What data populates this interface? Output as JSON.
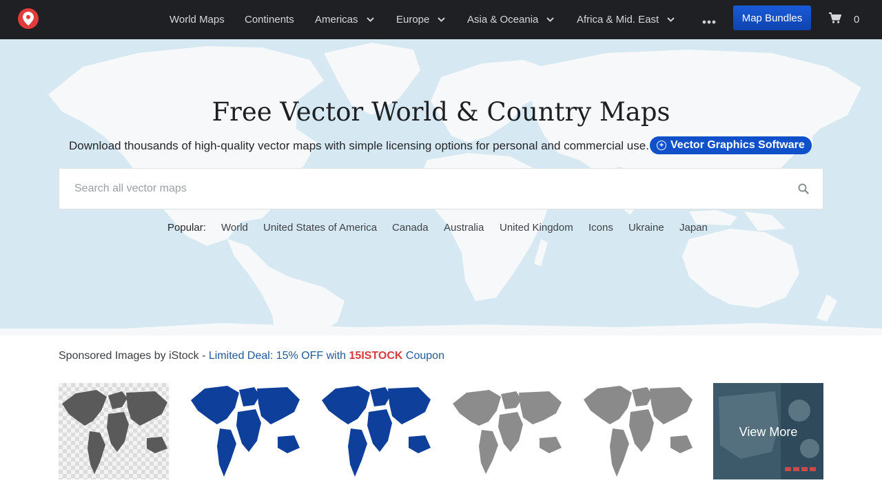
{
  "nav": {
    "items": [
      {
        "label": "World Maps"
      },
      {
        "label": "Continents"
      },
      {
        "label": "Americas"
      },
      {
        "label": "Europe"
      },
      {
        "label": "Asia & Oceania"
      },
      {
        "label": "Africa & Mid. East"
      }
    ],
    "more_icon": "more-dots-icon",
    "bundles_label": "Map Bundles",
    "cart_count": "0"
  },
  "hero": {
    "title": "Free Vector World & Country Maps",
    "subtitle": "Download thousands of high-quality vector maps with simple licensing options for personal and commercial use.",
    "pill_label": "Vector Graphics Software",
    "search_placeholder": "Search all vector maps",
    "popular_label": "Popular:",
    "popular_links": [
      "World",
      "United States of America",
      "Canada",
      "Australia",
      "United Kingdom",
      "Icons",
      "Ukraine",
      "Japan"
    ]
  },
  "sponsored": {
    "prefix": "Sponsored Images by iStock - ",
    "deal": "Limited Deal: 15% OFF with ",
    "code": "15ISTOCK",
    "suffix": " Coupon",
    "view_more": "View More"
  },
  "colors": {
    "nav_bg": "#1f2024",
    "accent_blue": "#1050c8",
    "hero_water": "#d6e9f2",
    "land": "#f6f8f9",
    "coupon_red": "#d93b3b",
    "logo_red": "#e23b3b"
  }
}
